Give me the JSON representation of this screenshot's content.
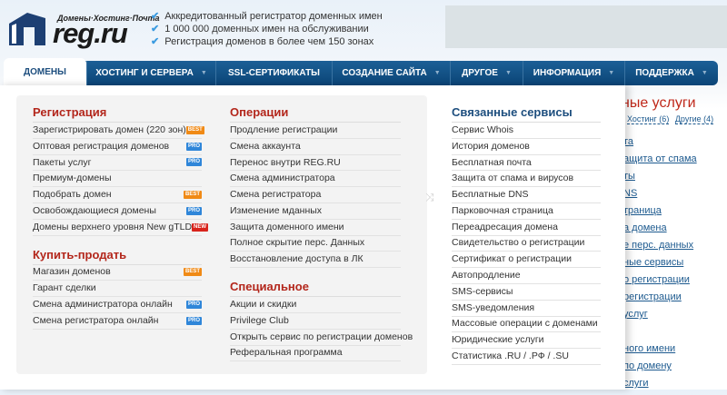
{
  "header": {
    "logo_tagline": "Домены·Хостинг·Почта",
    "logo_word": "reg.ru",
    "features": [
      "Аккредитованный регистратор доменных имен",
      "1 000 000 доменных имен на обслуживании",
      "Регистрация доменов в более чем 150 зонах"
    ]
  },
  "nav": [
    {
      "label": "ДОМЕНЫ",
      "active": true,
      "dropdown": false
    },
    {
      "label": "ХОСТИНГ И СЕРВЕРА",
      "dropdown": true
    },
    {
      "label": "SSL-СЕРТИФИКАТЫ",
      "dropdown": false
    },
    {
      "label": "СОЗДАНИЕ САЙТА",
      "dropdown": true
    },
    {
      "label": "ДРУГОЕ",
      "dropdown": true
    },
    {
      "label": "ИНФОРМАЦИЯ",
      "dropdown": true
    },
    {
      "label": "ПОДДЕРЖКА",
      "dropdown": true
    }
  ],
  "dropdown": {
    "registration": {
      "title": "Регистрация",
      "items": [
        {
          "label": "Зарегистрировать домен (220 зон)",
          "badge": "BEST"
        },
        {
          "label": "Оптовая регистрация доменов",
          "badge": "PRO"
        },
        {
          "label": "Пакеты услуг",
          "badge": "PRO"
        },
        {
          "label": "Премиум-домены",
          "badge": ""
        },
        {
          "label": "Подобрать домен",
          "badge": "BEST"
        },
        {
          "label": "Освобождающиеся домены",
          "badge": "PRO"
        },
        {
          "label": "Домены верхнего уровня New gTLD",
          "badge": "NEW"
        }
      ]
    },
    "buysell": {
      "title": "Купить-продать",
      "items": [
        {
          "label": "Магазин доменов",
          "badge": "BEST"
        },
        {
          "label": "Гарант сделки",
          "badge": ""
        },
        {
          "label": "Смена администратора онлайн",
          "badge": "PRO"
        },
        {
          "label": "Смена регистратора онлайн",
          "badge": "PRO"
        }
      ]
    },
    "operations": {
      "title": "Операции",
      "items": [
        "Продление регистрации",
        "Смена аккаунта",
        "Перенос внутри REG.RU",
        "Смена администратора",
        "Смена регистратора",
        "Изменение мданных",
        "Защита доменного имени",
        "Полное скрытие перс. Данных",
        "Восстановление доступа в ЛК"
      ]
    },
    "special": {
      "title": "Специальное",
      "items": [
        "Акции и скидки",
        "Privilege Club",
        "Открыть сервис по регистрации доменов",
        "Реферальная программа"
      ]
    },
    "related": {
      "title": "Связанные сервисы",
      "items": [
        "Сервис Whois",
        "История доменов",
        "Бесплатная почта",
        "Защита от спама и вирусов",
        "Бесплатные DNS",
        "Парковочная страница",
        "Переадресация домена",
        "Свидетельство о регистрации",
        "Сертификат о регистрации",
        "Автопродление",
        "SMS-сервисы",
        "SMS-уведомления",
        "Массовые операции с доменами",
        "Юридические услуги",
        "Статистика .RU / .РФ / .SU"
      ]
    }
  },
  "background": {
    "title": "ные услуги",
    "filters": [
      "Хостинг (6)",
      "Другие (4)"
    ],
    "links": [
      "та",
      "ащита от спама",
      "ты",
      "NS",
      "траница",
      "а домена",
      "е перс. данных",
      "ные сервисы",
      "о регистрации",
      "регистрации",
      "услуг",
      "",
      "ного имени",
      "по домену",
      "слуги"
    ]
  }
}
